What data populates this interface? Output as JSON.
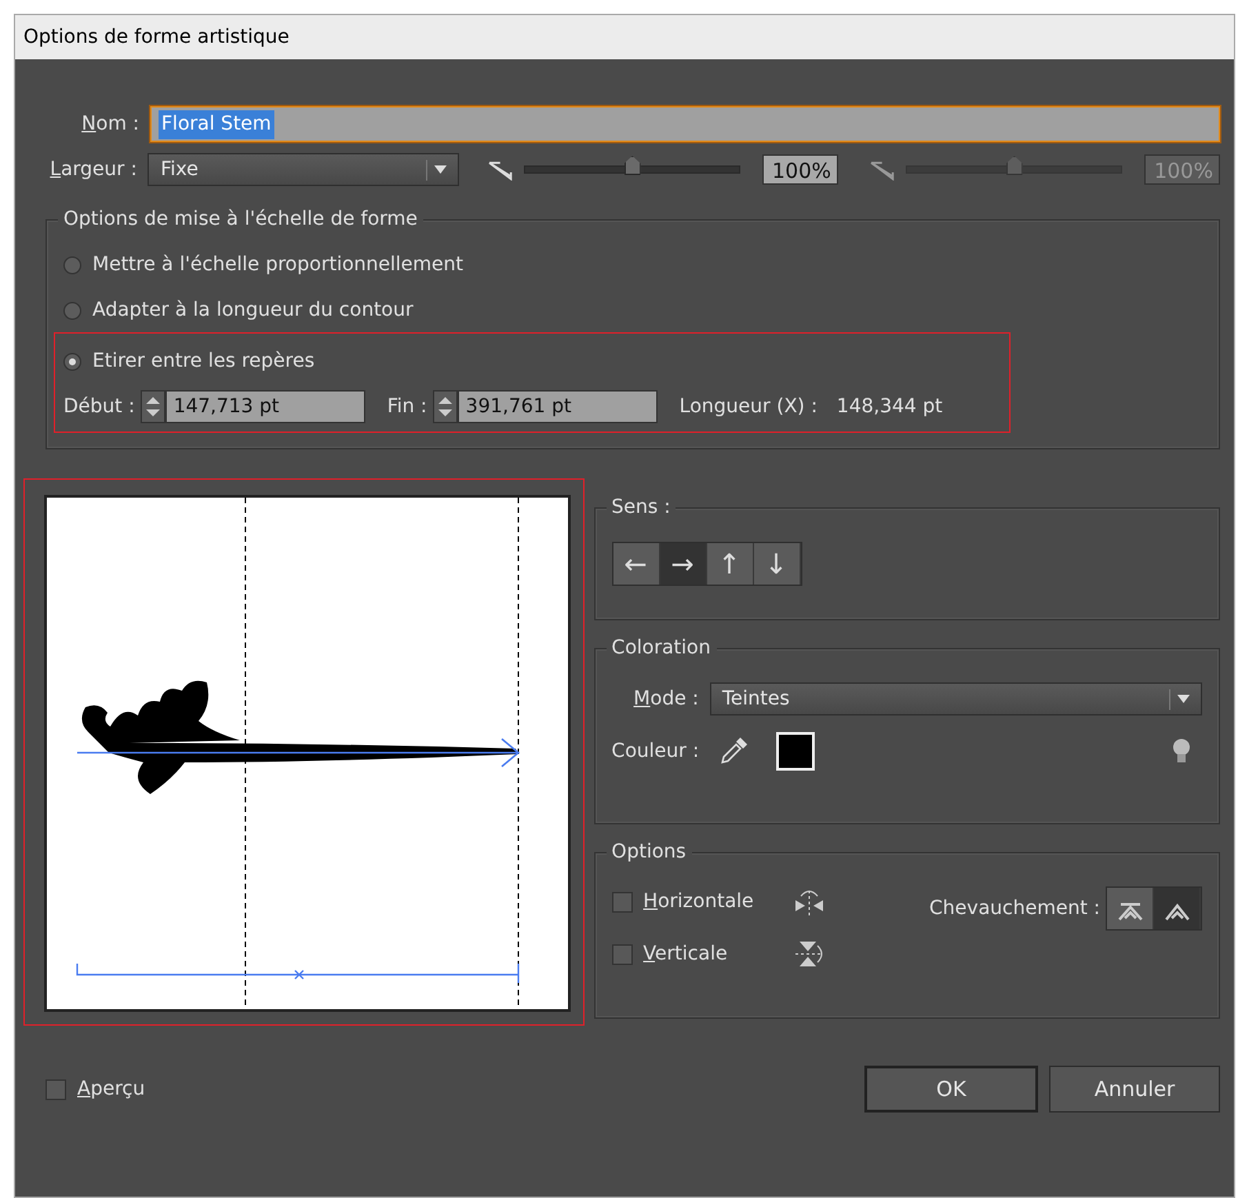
{
  "window": {
    "title": "Options de forme artistique"
  },
  "name_field": {
    "label": "Nom :",
    "mnemonic": true,
    "value": "Floral Stem",
    "text_selected": true
  },
  "width_row": {
    "label": "Largeur :",
    "mnemonic": true,
    "dropdown": "Fixe",
    "sliders": [
      {
        "level": 0.5,
        "reading": "100%",
        "disabled": false
      },
      {
        "level": 0.5,
        "reading": "100%",
        "disabled": true
      }
    ]
  },
  "scale_group": {
    "title": "Options de mise à l'échelle de forme",
    "options": [
      {
        "label": "Mettre à l'échelle proportionnellement",
        "selected": false
      },
      {
        "label": "Adapter à la longueur du contour",
        "selected": false
      },
      {
        "label": "Etirer entre les repères",
        "selected": true
      }
    ],
    "highlighted": true,
    "start": {
      "label": "Début :",
      "value": "147,713 pt"
    },
    "end": {
      "label": "Fin :",
      "value": "391,761 pt"
    },
    "length": {
      "label": "Longueur (X) :",
      "value": "148,344 pt"
    }
  },
  "preview": {
    "highlighted": true
  },
  "direction_group": {
    "title": "Sens :",
    "buttons": [
      {
        "glyph": "←",
        "selected": false
      },
      {
        "glyph": "→",
        "selected": true
      },
      {
        "glyph": "↑",
        "selected": false
      },
      {
        "glyph": "↓",
        "selected": false
      }
    ]
  },
  "coloration_group": {
    "title": "Coloration",
    "mode_label": "Mode :",
    "mode_mnemonic": true,
    "mode": "Teintes",
    "color_label": "Couleur :"
  },
  "options_group": {
    "title": "Options",
    "flips": [
      {
        "label": "Horizontale",
        "mnemonic": true,
        "checked": false,
        "kind": "horizontal"
      },
      {
        "label": "Verticale",
        "mnemonic": true,
        "checked": false,
        "kind": "vertical"
      }
    ],
    "overlap_label": "Chevauchement :",
    "overlap": [
      {
        "kind": "adjust",
        "selected": false
      },
      {
        "kind": "overlap",
        "selected": true
      }
    ]
  },
  "preview_checkbox": {
    "label": "Aperçu",
    "mnemonic": true,
    "checked": false
  },
  "buttons": [
    {
      "label": "OK",
      "default": true
    },
    {
      "label": "Annuler",
      "default": false
    }
  ]
}
